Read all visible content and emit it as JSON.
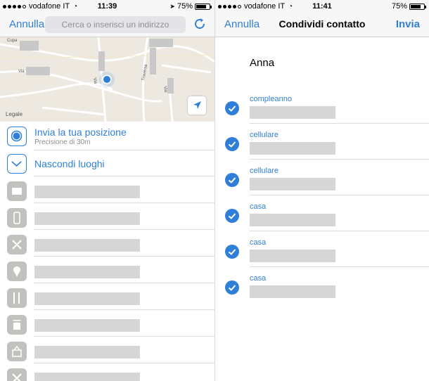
{
  "left": {
    "status": {
      "carrier": "vodafone IT",
      "time": "11:39",
      "battery": "75%",
      "battery_level": 0.75
    },
    "nav": {
      "cancel_label": "Annulla",
      "search_placeholder": "Cerca o inserisci un indirizzo"
    },
    "map": {
      "legal": "Legale",
      "street_1": "Cupa",
      "street_2": "Via",
      "street_3": "Via",
      "street_4": "Traversa",
      "street_5": "Via"
    },
    "send_location": {
      "title": "Invia la tua posizione",
      "subtitle": "Precisione di 30m"
    },
    "hide_places": {
      "title": "Nascondi luoghi"
    },
    "places": [
      {
        "icon": "theater-icon"
      },
      {
        "icon": "drink-icon"
      },
      {
        "icon": "tools-icon"
      },
      {
        "icon": "pin-icon"
      },
      {
        "icon": "restaurant-icon"
      },
      {
        "icon": "coffee-icon"
      },
      {
        "icon": "grocery-icon"
      },
      {
        "icon": "tools-icon"
      }
    ]
  },
  "right": {
    "status": {
      "carrier": "vodafone IT",
      "time": "11:41",
      "battery": "75%",
      "battery_level": 0.75
    },
    "nav": {
      "cancel_label": "Annulla",
      "title": "Condividi contatto",
      "send_label": "Invia"
    },
    "contact_name": "Anna",
    "fields": [
      {
        "label": "compleanno"
      },
      {
        "label": "cellulare"
      },
      {
        "label": "cellulare"
      },
      {
        "label": "casa"
      },
      {
        "label": "casa"
      },
      {
        "label": "casa"
      }
    ]
  },
  "colors": {
    "accent": "#2f7fd8",
    "placeholder_bar": "#d6d6d6",
    "icon_gray": "#c2c1bd",
    "map_bg": "#ede9e1"
  }
}
